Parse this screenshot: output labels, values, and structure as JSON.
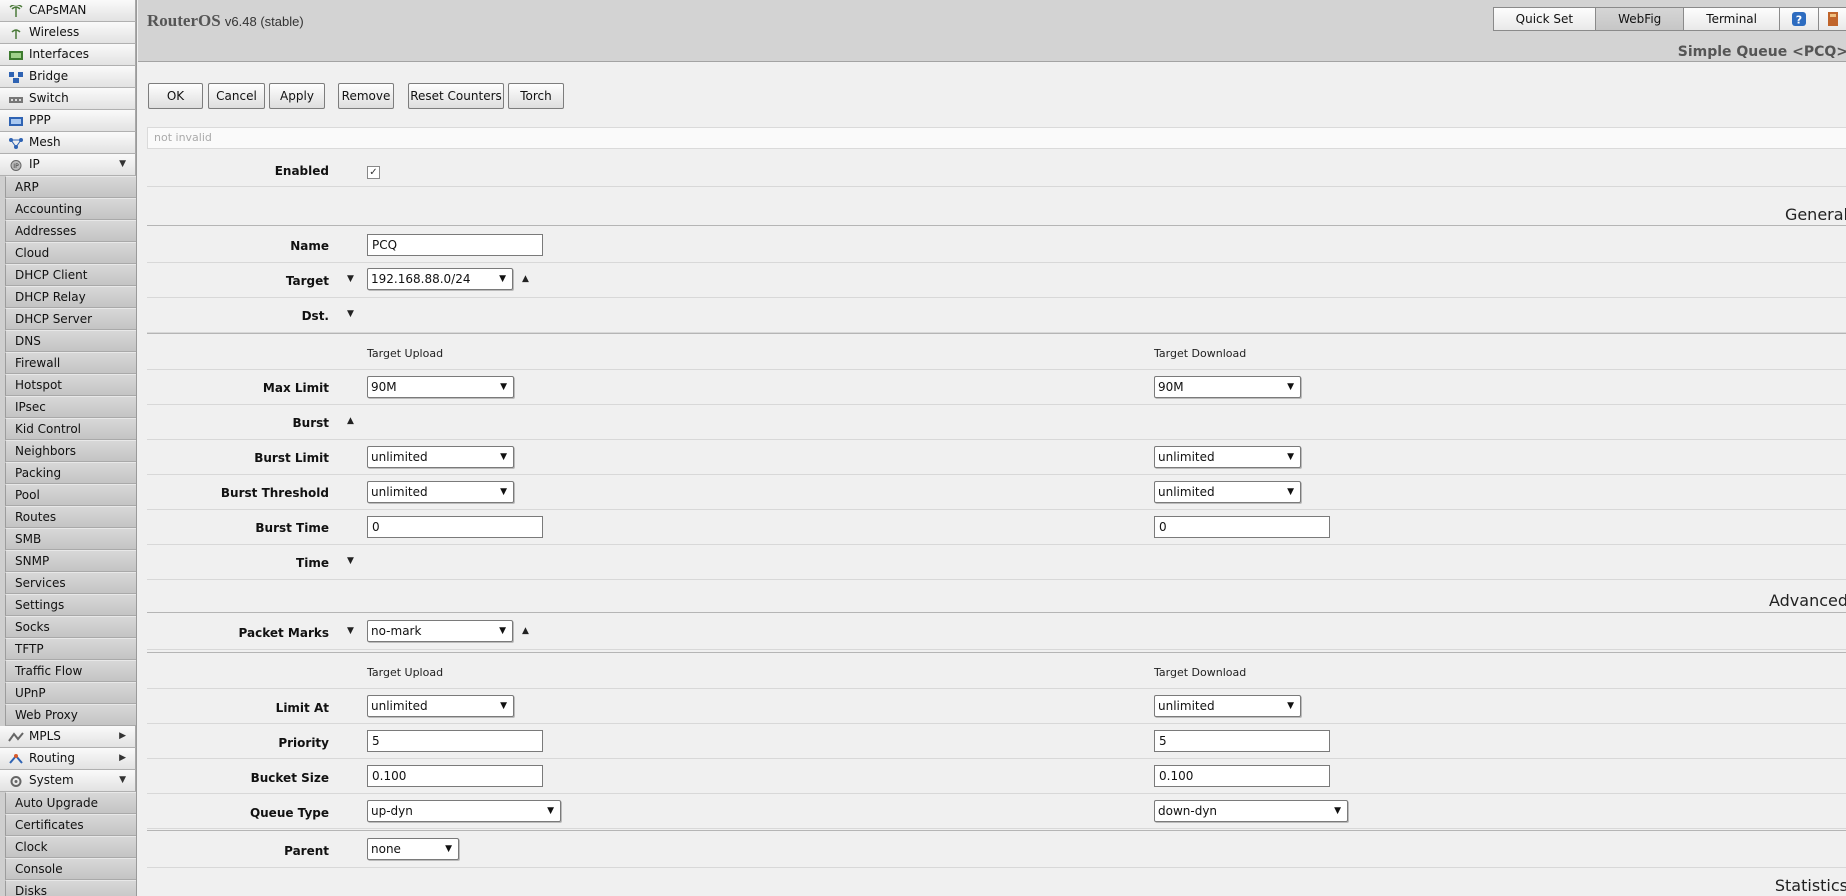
{
  "app": {
    "name": "RouterOS",
    "version": "v6.48 (stable)"
  },
  "top_buttons": [
    "Quick Set",
    "WebFig",
    "Terminal"
  ],
  "page_title": "Simple Queue <PCQ>",
  "sidebar": {
    "top_items": [
      {
        "label": "CAPsMAN",
        "icon": "capsman-icon"
      },
      {
        "label": "Wireless",
        "icon": "wireless-icon"
      },
      {
        "label": "Interfaces",
        "icon": "interfaces-icon"
      },
      {
        "label": "Bridge",
        "icon": "bridge-icon"
      },
      {
        "label": "Switch",
        "icon": "switch-icon"
      },
      {
        "label": "PPP",
        "icon": "ppp-icon"
      },
      {
        "label": "Mesh",
        "icon": "mesh-icon"
      }
    ],
    "ip": {
      "label": "IP",
      "items": [
        "ARP",
        "Accounting",
        "Addresses",
        "Cloud",
        "DHCP Client",
        "DHCP Relay",
        "DHCP Server",
        "DNS",
        "Firewall",
        "Hotspot",
        "IPsec",
        "Kid Control",
        "Neighbors",
        "Packing",
        "Pool",
        "Routes",
        "SMB",
        "SNMP",
        "Services",
        "Settings",
        "Socks",
        "TFTP",
        "Traffic Flow",
        "UPnP",
        "Web Proxy"
      ]
    },
    "mpls": {
      "label": "MPLS"
    },
    "routing": {
      "label": "Routing"
    },
    "system": {
      "label": "System",
      "items": [
        "Auto Upgrade",
        "Certificates",
        "Clock",
        "Console",
        "Disks"
      ]
    }
  },
  "toolbar": {
    "ok": "OK",
    "cancel": "Cancel",
    "apply": "Apply",
    "remove": "Remove",
    "reset_counters": "Reset Counters",
    "torch": "Torch"
  },
  "status_text": "not invalid",
  "sections": {
    "general": "General",
    "advanced": "Advanced",
    "statistics": "Statistics"
  },
  "form": {
    "enabled": {
      "label": "Enabled",
      "checked": true,
      "mark": "✓"
    },
    "name": {
      "label": "Name",
      "value": "PCQ"
    },
    "target": {
      "label": "Target",
      "value": "192.168.88.0/24"
    },
    "dst": {
      "label": "Dst."
    },
    "col_upload": "Target Upload",
    "col_download": "Target Download",
    "max_limit": {
      "label": "Max Limit",
      "upload": "90M",
      "download": "90M"
    },
    "burst": {
      "label": "Burst"
    },
    "burst_limit": {
      "label": "Burst Limit",
      "upload": "unlimited",
      "download": "unlimited"
    },
    "burst_threshold": {
      "label": "Burst Threshold",
      "upload": "unlimited",
      "download": "unlimited"
    },
    "burst_time": {
      "label": "Burst Time",
      "upload": "0",
      "download": "0"
    },
    "time": {
      "label": "Time"
    },
    "packet_marks": {
      "label": "Packet Marks",
      "value": "no-mark"
    },
    "limit_at": {
      "label": "Limit At",
      "upload": "unlimited",
      "download": "unlimited"
    },
    "priority": {
      "label": "Priority",
      "upload": "5",
      "download": "5"
    },
    "bucket_size": {
      "label": "Bucket Size",
      "upload": "0.100",
      "download": "0.100"
    },
    "queue_type": {
      "label": "Queue Type",
      "upload": "up-dyn",
      "download": "down-dyn"
    },
    "parent": {
      "label": "Parent",
      "value": "none"
    }
  }
}
